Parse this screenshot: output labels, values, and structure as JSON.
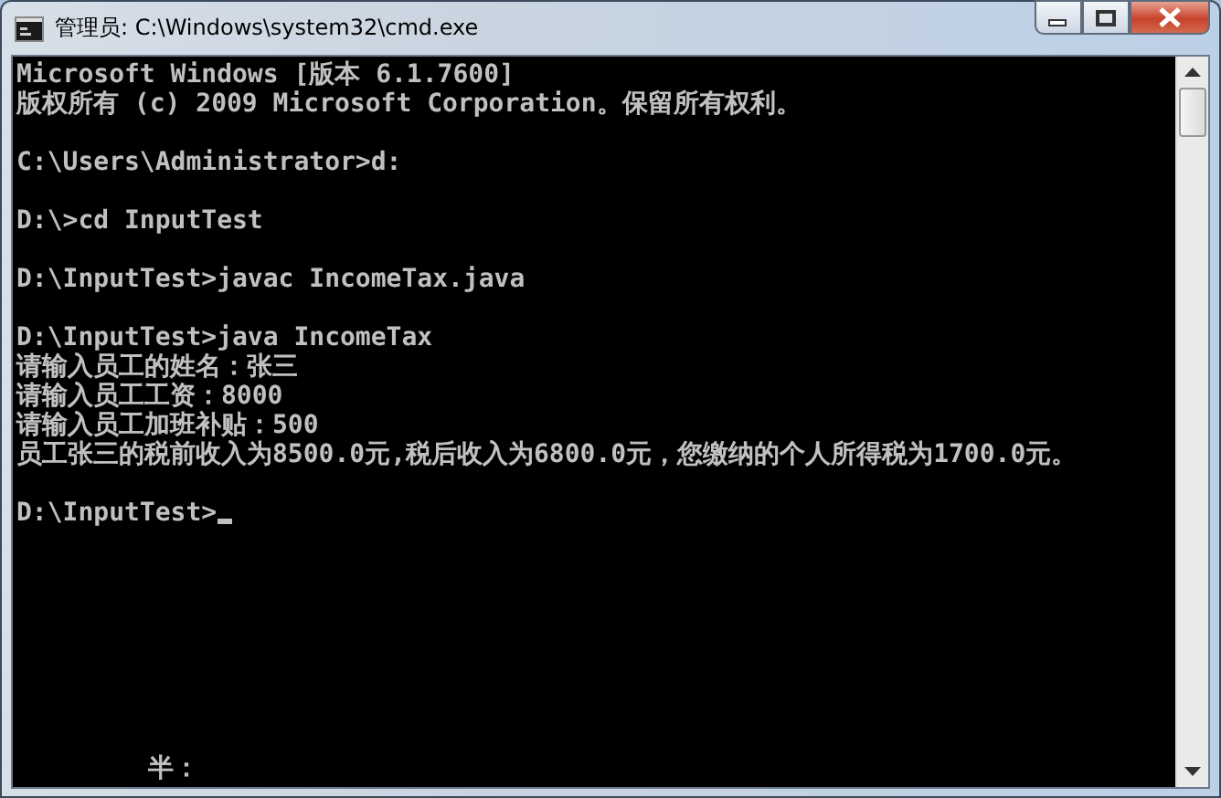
{
  "window": {
    "title": "管理员: C:\\Windows\\system32\\cmd.exe"
  },
  "console": {
    "blocks": [
      [
        "Microsoft Windows [版本 6.1.7600]",
        "版权所有 (c) 2009 Microsoft Corporation。保留所有权利。"
      ],
      [
        "C:\\Users\\Administrator>d:"
      ],
      [
        "D:\\>cd InputTest"
      ],
      [
        "D:\\InputTest>javac IncomeTax.java"
      ],
      [
        "D:\\InputTest>java IncomeTax",
        "请输入员工的姓名：张三",
        "请输入员工工资：8000",
        "请输入员工加班补贴：500",
        "员工张三的税前收入为8500.0元,税后收入为6800.0元，您缴纳的个人所得税为1700.0元。"
      ],
      [
        "D:\\InputTest>"
      ]
    ],
    "cursor": true,
    "ime_status": "半："
  }
}
